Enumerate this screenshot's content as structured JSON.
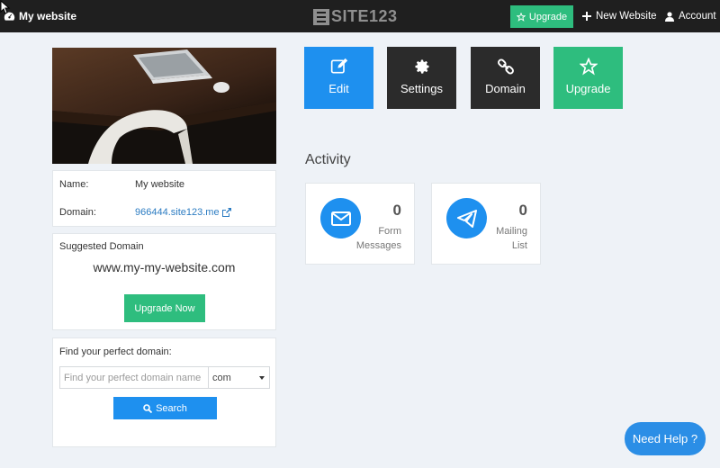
{
  "topbar": {
    "site_name": "My website",
    "logo_text": "SITE123",
    "upgrade_label": "Upgrade",
    "new_website_label": "New Website",
    "account_label": "Account"
  },
  "site_info": {
    "name_label": "Name:",
    "name_value": "My website",
    "domain_label": "Domain:",
    "domain_value": "966444.site123.me"
  },
  "suggested": {
    "title": "Suggested Domain",
    "domain": "www.my-my-website.com",
    "button": "Upgrade Now"
  },
  "find_domain": {
    "title": "Find your perfect domain:",
    "placeholder": "Find your perfect domain name",
    "tld": "com",
    "button": "Search"
  },
  "actions": [
    {
      "label": "Edit",
      "icon": "edit-icon",
      "color": "#1e90ef"
    },
    {
      "label": "Settings",
      "icon": "gear-icon",
      "color": "#2b2b2b"
    },
    {
      "label": "Domain",
      "icon": "link-icon",
      "color": "#2b2b2b"
    },
    {
      "label": "Upgrade",
      "icon": "star-icon",
      "color": "#2ebd7e"
    }
  ],
  "activity": {
    "title": "Activity",
    "stats": [
      {
        "count": "0",
        "label_line1": "Form",
        "label_line2": "Messages",
        "icon": "envelope-icon"
      },
      {
        "count": "0",
        "label_line1": "Mailing",
        "label_line2": "List",
        "icon": "paper-plane-icon"
      }
    ]
  },
  "help": {
    "label": "Need Help ?"
  },
  "colors": {
    "accent": "#1e90ef",
    "green": "#2ebd7e",
    "topbar": "#1f1f1f",
    "background": "#eef2f7"
  }
}
